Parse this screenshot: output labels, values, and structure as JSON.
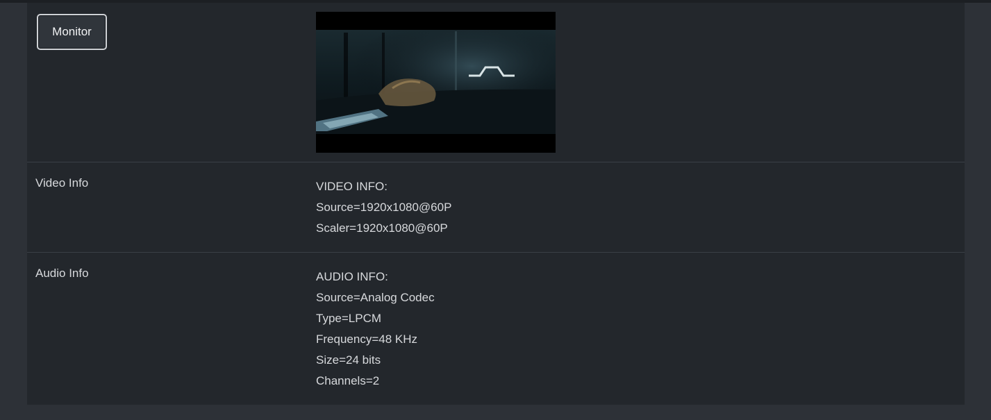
{
  "monitor": {
    "button_label": "Monitor"
  },
  "video": {
    "label": "Video Info",
    "lines": [
      "VIDEO INFO:",
      "Source=1920x1080@60P",
      "Scaler=1920x1080@60P"
    ]
  },
  "audio": {
    "label": "Audio Info",
    "lines": [
      "AUDIO INFO:",
      "Source=Analog Codec",
      "Type=LPCM",
      "Frequency=48 KHz",
      "Size=24 bits",
      "Channels=2"
    ]
  },
  "colors": {
    "background": "#2d3137",
    "panel": "#23272c",
    "divider": "#3a3f46",
    "text": "#d7d9dc"
  }
}
